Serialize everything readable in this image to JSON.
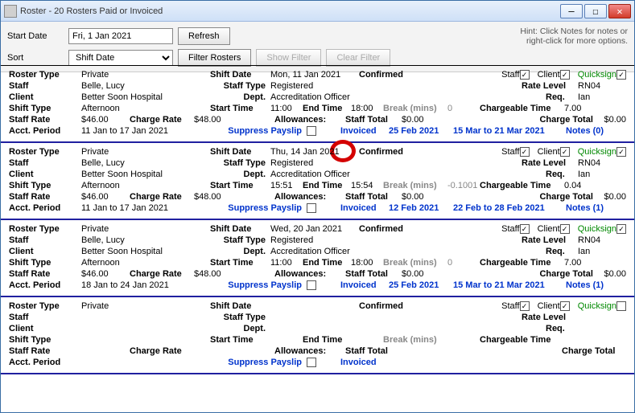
{
  "window": {
    "title": "Roster - 20 Rosters Paid or Invoiced"
  },
  "toolbar": {
    "start_date_lbl": "Start Date",
    "start_date_val": "Fri, 1 Jan 2021",
    "refresh": "Refresh",
    "sort_lbl": "Sort",
    "sort_val": "Shift Date",
    "filter": "Filter Rosters",
    "show_filter": "Show Filter",
    "clear_filter": "Clear Filter",
    "hint": "Hint: Click Notes for notes or\nright-click for more options."
  },
  "labels": {
    "roster_type": "Roster Type",
    "staff": "Staff",
    "client": "Client",
    "shift_type": "Shift Type",
    "staff_rate": "Staff Rate",
    "charge_rate": "Charge Rate",
    "acct_period": "Acct. Period",
    "shift_date": "Shift Date",
    "staff_type": "Staff Type",
    "dept": "Dept.",
    "start_time": "Start Time",
    "end_time": "End Time",
    "break": "Break (mins)",
    "chargeable": "Chargeable Time",
    "allowances": "Allowances:",
    "staff_total": "Staff Total",
    "charge_total": "Charge Total",
    "suppress": "Suppress Payslip",
    "confirmed": "Confirmed",
    "rate_level": "Rate Level",
    "req": "Req.",
    "invoiced": "Invoiced",
    "quicksign": "Quicksign",
    "staff_c": "Staff",
    "client_c": "Client"
  },
  "rosters": [
    {
      "roster_type": "Private",
      "staff": "Belle, Lucy",
      "client": "Better Soon Hospital",
      "shift_type": "Afternoon",
      "staff_rate": "$46.00",
      "charge_rate": "$48.00",
      "acct_period": "11 Jan to 17 Jan 2021",
      "shift_date": "Mon, 11 Jan 2021",
      "staff_type": "Registered",
      "dept": "Accreditation Officer",
      "start_time": "11:00",
      "end_time": "18:00",
      "break": "0",
      "chargeable": "7.00",
      "staff_total": "$0.00",
      "charge_total": "$0.00",
      "suppress": false,
      "invoiced": "25 Feb 2021",
      "notes": "Notes (0)",
      "pay_range": "15 Mar to 21 Mar 2021",
      "rate_level": "RN04",
      "req": "Ian",
      "staff_chk": true,
      "client_chk": true,
      "quicksign_chk": true,
      "circle": true
    },
    {
      "roster_type": "Private",
      "staff": "Belle, Lucy",
      "client": "Better Soon Hospital",
      "shift_type": "Afternoon",
      "staff_rate": "$46.00",
      "charge_rate": "$48.00",
      "acct_period": "11 Jan to 17 Jan 2021",
      "shift_date": "Thu, 14 Jan 2021",
      "staff_type": "Registered",
      "dept": "Accreditation Officer",
      "start_time": "15:51",
      "end_time": "15:54",
      "break": "-0.1001",
      "chargeable": "0.04",
      "staff_total": "$0.00",
      "charge_total": "$0.00",
      "suppress": false,
      "invoiced": "12 Feb 2021",
      "notes": "Notes (1)",
      "pay_range": "22 Feb to 28 Feb 2021",
      "rate_level": "RN04",
      "req": "Ian",
      "staff_chk": true,
      "client_chk": true,
      "quicksign_chk": true,
      "circle": false
    },
    {
      "roster_type": "Private",
      "staff": "Belle, Lucy",
      "client": "Better Soon Hospital",
      "shift_type": "Afternoon",
      "staff_rate": "$46.00",
      "charge_rate": "$48.00",
      "acct_period": "18 Jan to 24 Jan 2021",
      "shift_date": "Wed, 20 Jan 2021",
      "staff_type": "Registered",
      "dept": "Accreditation Officer",
      "start_time": "11:00",
      "end_time": "18:00",
      "break": "0",
      "chargeable": "7.00",
      "staff_total": "$0.00",
      "charge_total": "$0.00",
      "suppress": false,
      "invoiced": "25 Feb 2021",
      "notes": "Notes (1)",
      "pay_range": "15 Mar to 21 Mar 2021",
      "rate_level": "RN04",
      "req": "Ian",
      "staff_chk": true,
      "client_chk": true,
      "quicksign_chk": true,
      "circle": false
    },
    {
      "roster_type": "Private",
      "staff": "",
      "client": "",
      "shift_type": "",
      "staff_rate": "",
      "charge_rate": "",
      "acct_period": "",
      "shift_date": "",
      "staff_type": "",
      "dept": "",
      "start_time": "",
      "end_time": "",
      "break": "",
      "chargeable": "",
      "staff_total": "",
      "charge_total": "",
      "suppress": false,
      "invoiced": "",
      "notes": "",
      "pay_range": "",
      "rate_level": "",
      "req": "",
      "staff_chk": true,
      "client_chk": true,
      "quicksign_chk": false,
      "circle": false
    }
  ]
}
